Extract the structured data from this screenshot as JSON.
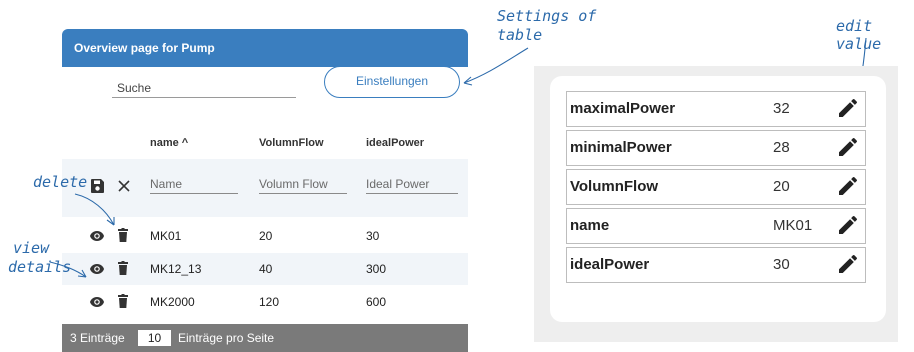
{
  "panel": {
    "title": "Overview page for Pump",
    "search_placeholder": "Suche",
    "settings_label": "Einstellungen"
  },
  "table": {
    "columns": [
      "name ^",
      "VolumnFlow",
      "idealPower"
    ],
    "filters": [
      "Name",
      "Volumn Flow",
      "Ideal Power"
    ],
    "rows": [
      {
        "name": "MK01",
        "volumnFlow": "20",
        "idealPower": "30"
      },
      {
        "name": "MK12_13",
        "volumnFlow": "40",
        "idealPower": "300"
      },
      {
        "name": "MK2000",
        "volumnFlow": "120",
        "idealPower": "600"
      }
    ]
  },
  "footer": {
    "count_text": "3 Einträge",
    "page_size": "10",
    "per_page_text": "Einträge pro Seite"
  },
  "annotations": {
    "settings": [
      "Settings of",
      "table"
    ],
    "edit": "edit value",
    "delete": "delete",
    "view": [
      "view",
      "details"
    ]
  },
  "properties": [
    {
      "name": "maximalPower",
      "value": "32"
    },
    {
      "name": "minimalPower",
      "value": "28"
    },
    {
      "name": "VolumnFlow",
      "value": "20"
    },
    {
      "name": "name",
      "value": "MK01"
    },
    {
      "name": "idealPower",
      "value": "30"
    }
  ],
  "colors": {
    "accent": "#3a7ebf",
    "annotation": "#2c6aaa",
    "footer": "#7a7a7a",
    "row_alt": "#f1f5f9"
  }
}
